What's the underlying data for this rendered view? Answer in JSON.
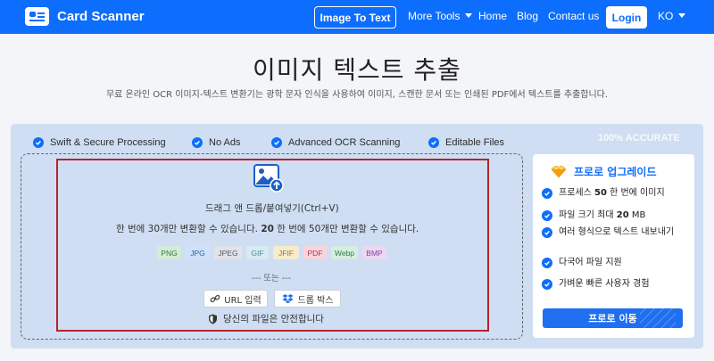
{
  "nav": {
    "brand": "Card Scanner",
    "image_to_text": "Image To Text",
    "more_tools": "More Tools",
    "home": "Home",
    "blog": "Blog",
    "contact": "Contact us",
    "login": "Login",
    "lang": "KO"
  },
  "page": {
    "title": "이미지 텍스트 추출",
    "subtitle": "무료 온라인 OCR 이미지-텍스트 변환기는 광학 문자 인식을 사용하여 이미지, 스캔한 문서 또는 인쇄된 PDF에서 텍스트를 추출합니다."
  },
  "features": [
    "Swift & Secure Processing",
    "No Ads",
    "Advanced OCR Scanning",
    "Editable Files"
  ],
  "accurate_badge": "100% ACCURATE",
  "upload": {
    "drag_text": "드래그 앤 드롭/붙여넣기(Ctrl+V)",
    "limit_pre": "한 번에 30개만 변환할 수 있습니다. ",
    "limit_num": "20",
    "limit_post": " 한 번에 50개만 변환할 수 있습니다.",
    "or_text": "--- 또는 ---",
    "url_button": "URL 입력",
    "dropbox_button": "드롭 박스",
    "safe_text": "당신의 파일은 안전합니다"
  },
  "formats": [
    {
      "label": "PNG",
      "bg": "#d3ecd6",
      "fg": "#2f7d3c"
    },
    {
      "label": "JPG",
      "bg": "#cfe0f8",
      "fg": "#2a62b8"
    },
    {
      "label": "JPEG",
      "bg": "#e1e3e8",
      "fg": "#555a63"
    },
    {
      "label": "GIF",
      "bg": "#d6ecf0",
      "fg": "#4f8c9a"
    },
    {
      "label": "JFIF",
      "bg": "#f6ebcc",
      "fg": "#9a7a22"
    },
    {
      "label": "PDF",
      "bg": "#f6d6dc",
      "fg": "#b2344c"
    },
    {
      "label": "Webp",
      "bg": "#d6eedd",
      "fg": "#2f7d49"
    },
    {
      "label": "BMP",
      "bg": "#ead8f1",
      "fg": "#8a3ea6"
    }
  ],
  "pro": {
    "title": "프로로 업그레이드",
    "items": [
      {
        "pre": "프로세스 ",
        "bold": "50",
        "post": " 한 번에 이미지"
      },
      {
        "pre": "파일 크기 최대 ",
        "bold": "20",
        "post": " MB"
      },
      {
        "pre": "여러 형식으로 텍스트 내보내기",
        "bold": "",
        "post": ""
      },
      {
        "pre": "다국어 파일 지원",
        "bold": "",
        "post": ""
      },
      {
        "pre": "가벼운 빠른 사용자 경험",
        "bold": "",
        "post": ""
      }
    ],
    "button": "프로로 이동"
  }
}
